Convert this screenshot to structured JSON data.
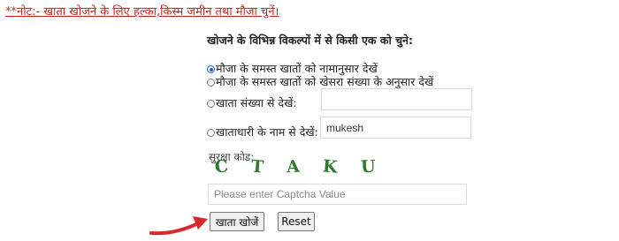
{
  "notice": "**नोट:- खाता खोजने के लिए हल्का,किस्म जमीन तथा मौजा चुनें।",
  "heading": "खोजने के विभिन्न विकल्पों में से किसी एक को चुने:",
  "options": [
    {
      "label": "मौजा के समस्त खातों को नामानुसार देखें",
      "checked": true
    },
    {
      "label": "मौजा के समस्त खातों को खेसरा संख्या के अनुसार देखें",
      "checked": false
    },
    {
      "label": "खाता संख्या से देखें:",
      "checked": false
    },
    {
      "label": "खाताधारी के नाम से देखें:",
      "checked": false
    }
  ],
  "khata_input": {
    "value": ""
  },
  "name_input": {
    "value": "mukesh"
  },
  "captcha": {
    "label": "सुरक्षा कोड:",
    "chars": [
      "C",
      "T",
      "A",
      "K",
      "U"
    ],
    "placeholder": "Please enter Captcha Value",
    "value": ""
  },
  "buttons": {
    "search": "खाता खोजें",
    "reset": "Reset"
  },
  "colors": {
    "notice": "#cc1f1f",
    "captcha": "#2f7a2f",
    "arrow": "#d42a2a",
    "radio": "#1a63c7"
  }
}
